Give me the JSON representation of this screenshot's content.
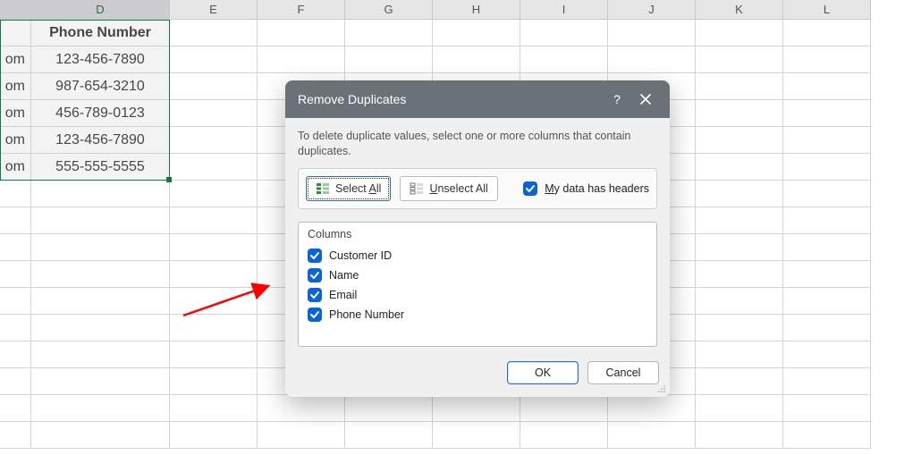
{
  "sheet": {
    "col_letters": [
      "D",
      "E",
      "F",
      "G",
      "H",
      "I",
      "J",
      "K",
      "L"
    ],
    "header_label": "Phone Number",
    "partial_text": "om",
    "phone_values": [
      "123-456-7890",
      "987-654-3210",
      "456-789-0123",
      "123-456-7890",
      "555-555-5555"
    ]
  },
  "dialog": {
    "title": "Remove Duplicates",
    "description": "To delete duplicate values, select one or more columns that contain duplicates.",
    "select_all": "Select All",
    "unselect_all": "Unselect All",
    "my_data_has_headers": "My data has headers",
    "columns_legend": "Columns",
    "columns": [
      "Customer ID",
      "Name",
      "Email",
      "Phone Number"
    ],
    "ok": "OK",
    "cancel": "Cancel"
  }
}
